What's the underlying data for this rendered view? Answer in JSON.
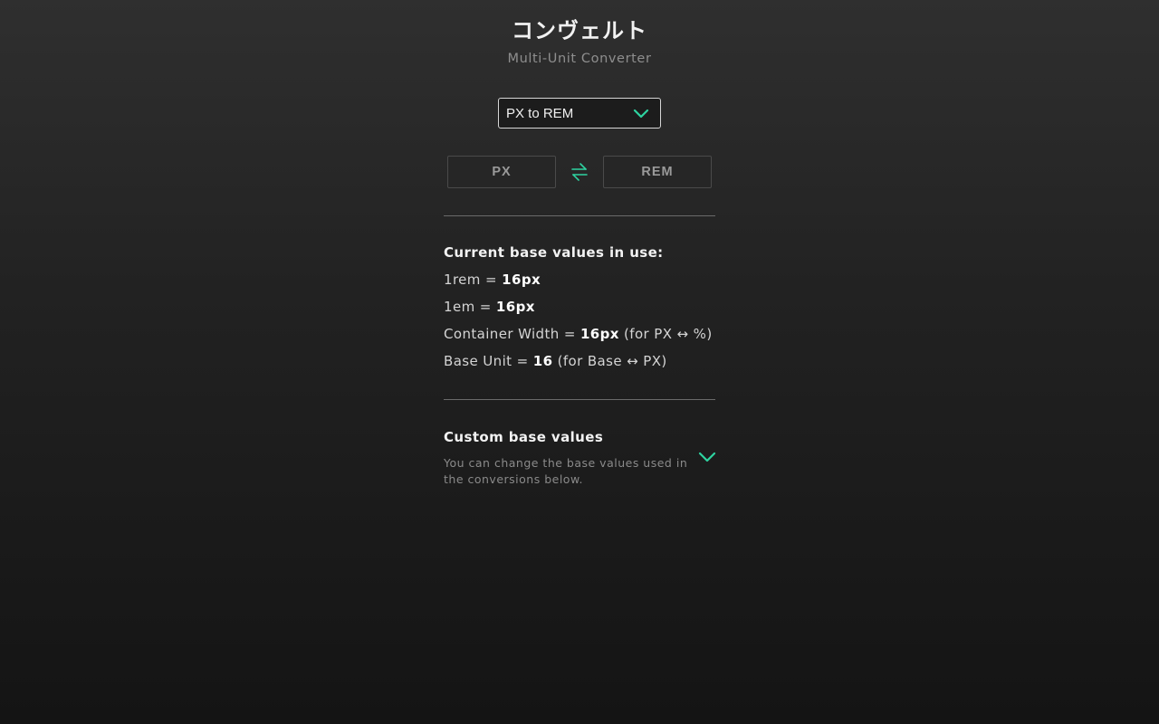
{
  "header": {
    "title": "コンヴェルト",
    "subtitle": "Multi-Unit Converter"
  },
  "conversion_select": {
    "value": "PX to REM",
    "icon": "chevron-down-icon"
  },
  "units": {
    "from": "PX",
    "to": "REM",
    "swap_icon": "swap-arrows-icon"
  },
  "current_base": {
    "heading": "Current base values in use:",
    "rem": {
      "label": "1rem = ",
      "value": "16px",
      "suffix": ""
    },
    "em": {
      "label": "1em = ",
      "value": "16px",
      "suffix": ""
    },
    "container_width": {
      "label": "Container Width = ",
      "value": "16px",
      "suffix": " (for PX ↔ %)"
    },
    "base_unit": {
      "label": "Base Unit = ",
      "value": "16",
      "suffix": " (for Base ↔ PX)"
    }
  },
  "custom_base": {
    "heading": "Custom base values",
    "description": "You can change the base values used in the conversions below.",
    "toggle_icon": "chevron-down-icon"
  },
  "colors": {
    "accent": "#2ed3a0",
    "background_top": "#2f2f2f",
    "background_bottom": "#141414",
    "text_primary": "#f2f2f2",
    "text_muted": "#8e8e8e",
    "divider": "#6a6a6a"
  }
}
